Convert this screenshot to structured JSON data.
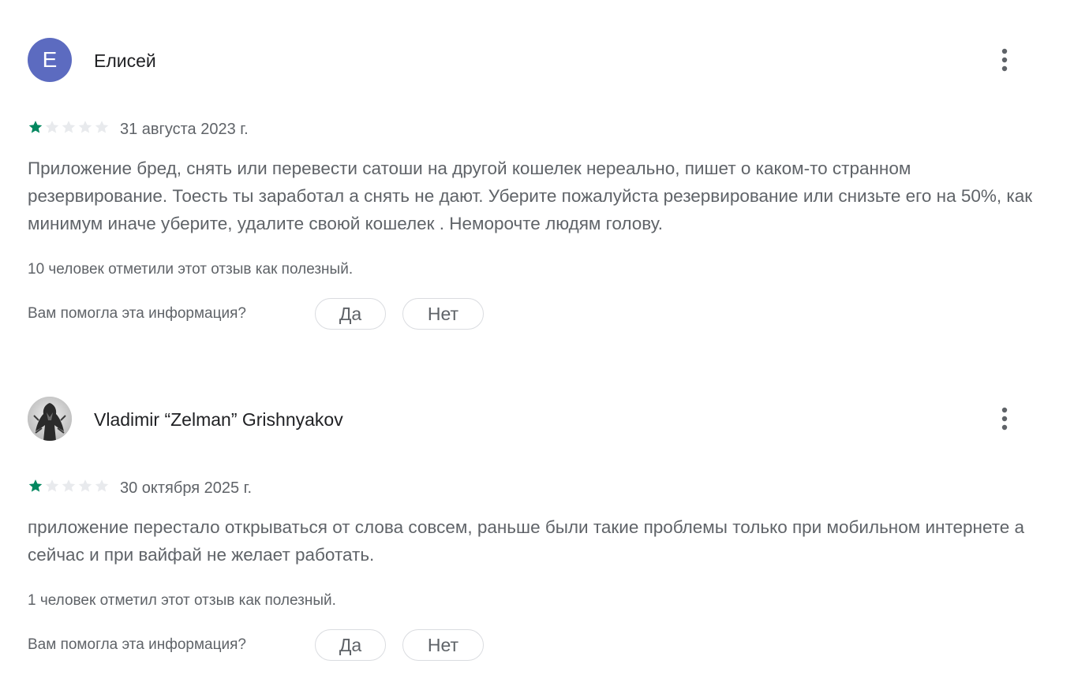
{
  "reviews": [
    {
      "avatar_letter": "Е",
      "avatar_color": "#5c6bc0",
      "author": "Елисей",
      "rating": 1,
      "rating_max": 5,
      "date": "31 августа 2023 г.",
      "text": "Приложение бред, снять или перевести сатоши на другой кошелек нереально, пишет о каком-то странном резервирование. Тоесть ты заработал а снять не дают. Уберите пожалуйста резервирование или снизьте его на 50%, как минимум иначе уберите, удалите своюй кошелек . Неморочте людям голову.",
      "helpful_count_text": "10 человек отметили этот отзыв как полезный.",
      "question": "Вам помогла эта информация?",
      "yes_label": "Да",
      "no_label": "Нет"
    },
    {
      "avatar_letter": "",
      "avatar_color": "#d6d6d6",
      "author": "Vladimir “Zelman” Grishnyakov",
      "rating": 1,
      "rating_max": 5,
      "date": "30 октября 2025 г.",
      "text": "приложение перестало открываться от слова совсем, раньше были такие проблемы только при мобильном интернете а сейчас и при вайфай не желает работать.",
      "helpful_count_text": "1 человек отметил этот отзыв как полезный.",
      "question": "Вам помогла эта информация?",
      "yes_label": "Да",
      "no_label": "Нет"
    }
  ],
  "colors": {
    "star_filled": "#01875f",
    "star_empty": "#e8eaed",
    "text_secondary": "#5f6368",
    "text_primary": "#202124"
  },
  "icons": {
    "menu": "more-vert-icon",
    "star": "star-icon"
  }
}
